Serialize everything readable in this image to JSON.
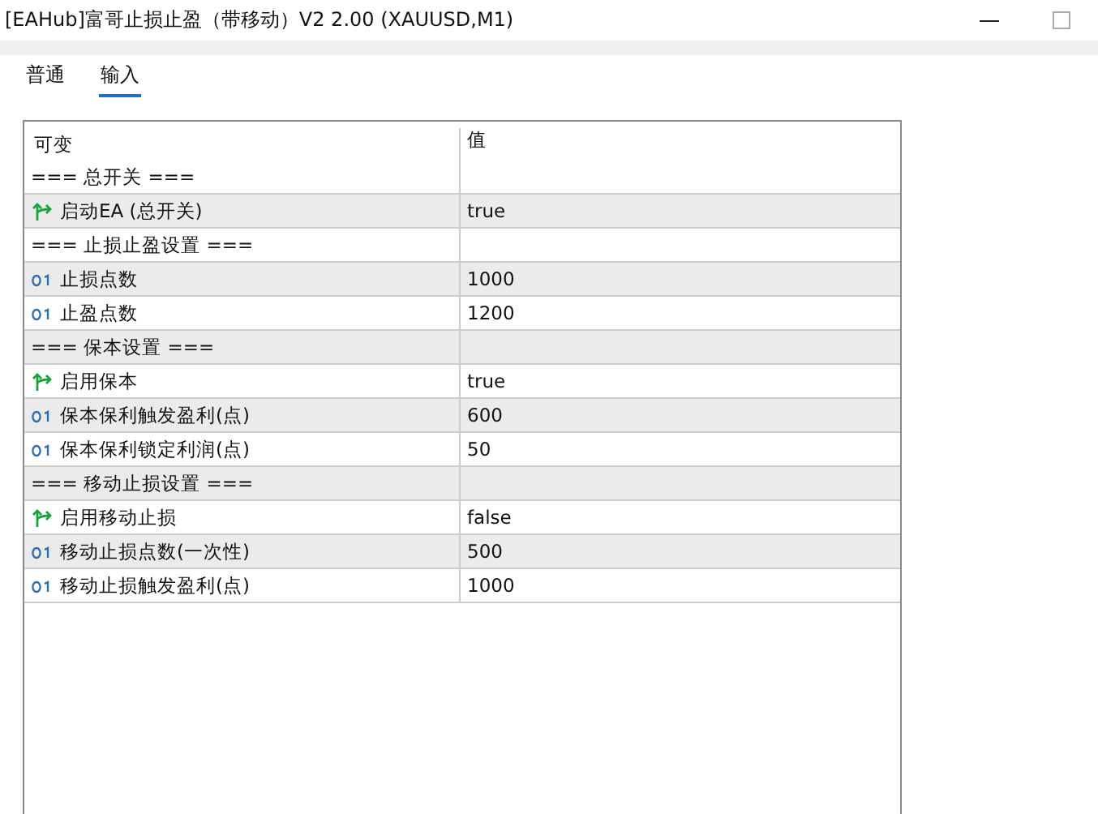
{
  "window": {
    "title": "[EAHub]富哥止损止盈（带移动）V2 2.00 (XAUUSD,M1)"
  },
  "tabs": [
    {
      "label": "普通",
      "selected": false
    },
    {
      "label": "输入",
      "selected": true
    }
  ],
  "table": {
    "columns": [
      "可变",
      "值"
    ],
    "rows": [
      {
        "kind": "section",
        "name": "=== 总开关 ==="
      },
      {
        "kind": "bool",
        "name": "启动EA (总开关)",
        "value": "true"
      },
      {
        "kind": "section",
        "name": "=== 止损止盈设置 ==="
      },
      {
        "kind": "int",
        "name": "止损点数",
        "value": "1000"
      },
      {
        "kind": "int",
        "name": "止盈点数",
        "value": "1200"
      },
      {
        "kind": "section",
        "name": "=== 保本设置 ==="
      },
      {
        "kind": "bool",
        "name": "启用保本",
        "value": "true"
      },
      {
        "kind": "int",
        "name": "保本保利触发盈利(点)",
        "value": "600"
      },
      {
        "kind": "int",
        "name": "保本保利锁定利润(点)",
        "value": "50"
      },
      {
        "kind": "section",
        "name": "=== 移动止损设置 ==="
      },
      {
        "kind": "bool",
        "name": "启用移动止损",
        "value": "false"
      },
      {
        "kind": "int",
        "name": "移动止损点数(一次性)",
        "value": "500"
      },
      {
        "kind": "int",
        "name": "移动止损触发盈利(点)",
        "value": "1000"
      }
    ]
  }
}
